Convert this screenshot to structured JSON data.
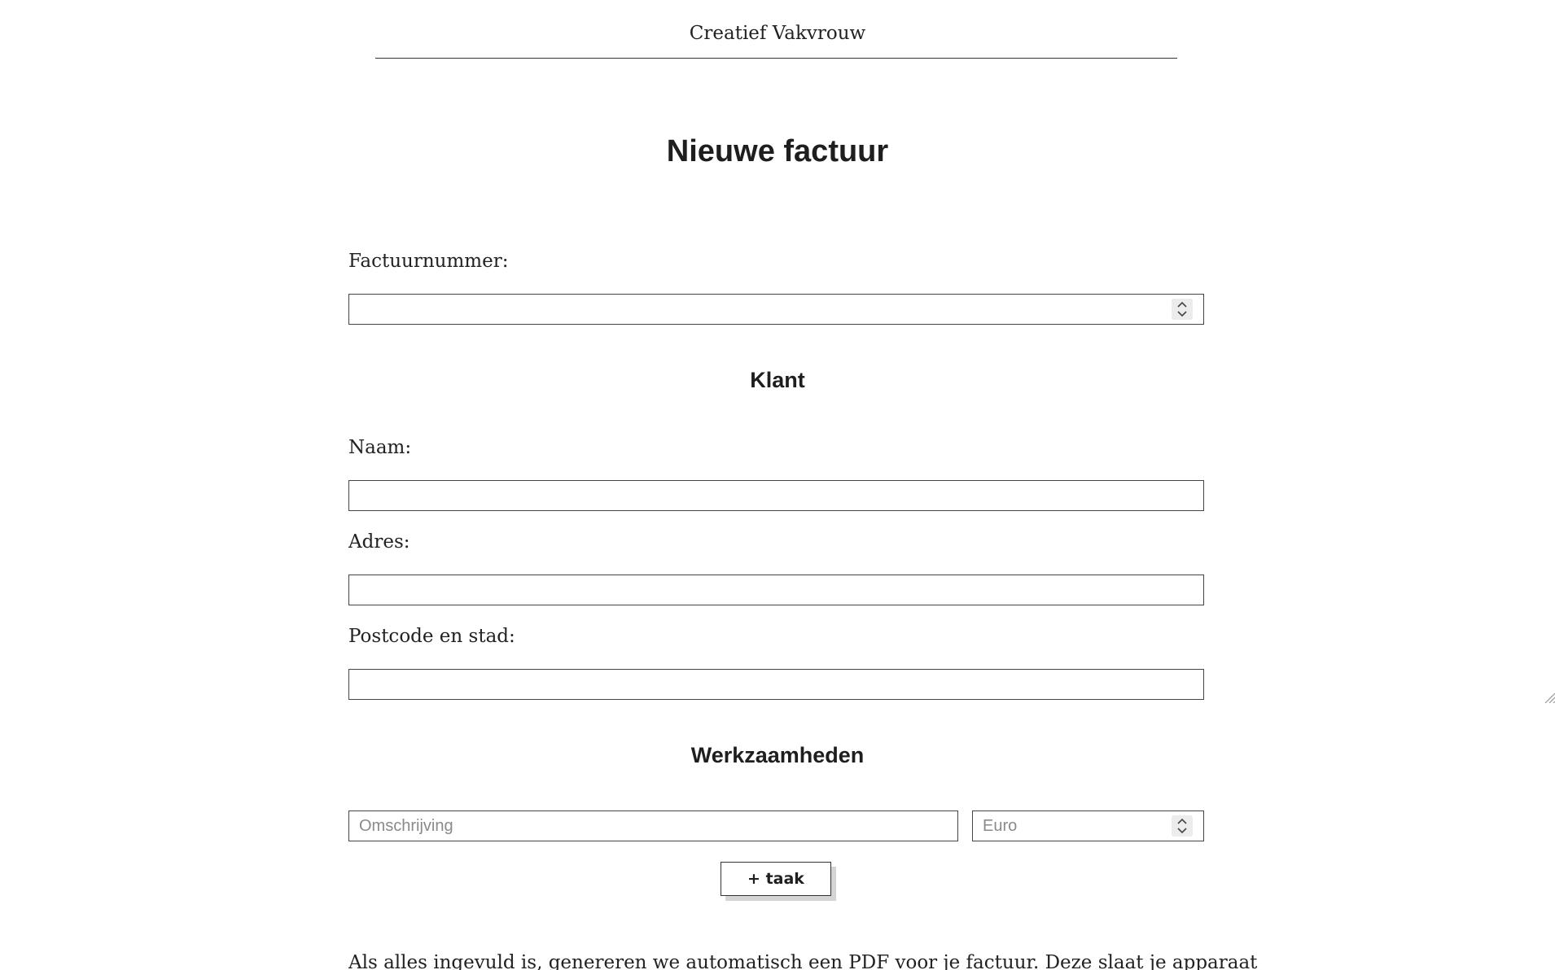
{
  "header": {
    "brand": "Creatief Vakvrouw"
  },
  "page": {
    "title": "Nieuwe factuur"
  },
  "invoice": {
    "number_label": "Factuurnummer:",
    "number_value": ""
  },
  "customer": {
    "section_title": "Klant",
    "name_label": "Naam:",
    "name_value": "",
    "address_label": "Adres:",
    "address_value": "",
    "postal_city_label": "Postcode en stad:",
    "postal_city_value": ""
  },
  "tasks": {
    "section_title": "Werkzaamheden",
    "description_placeholder": "Omschrijving",
    "amount_placeholder": "Euro",
    "add_button_label": "+ taak"
  },
  "footer": {
    "note": "Als alles ingevuld is, genereren we automatisch een PDF voor je factuur. Deze slaat je apparaat"
  },
  "icons": {
    "number_spinner": "spinner-arrows-icon",
    "resize_grip": "resize-grip-icon"
  }
}
